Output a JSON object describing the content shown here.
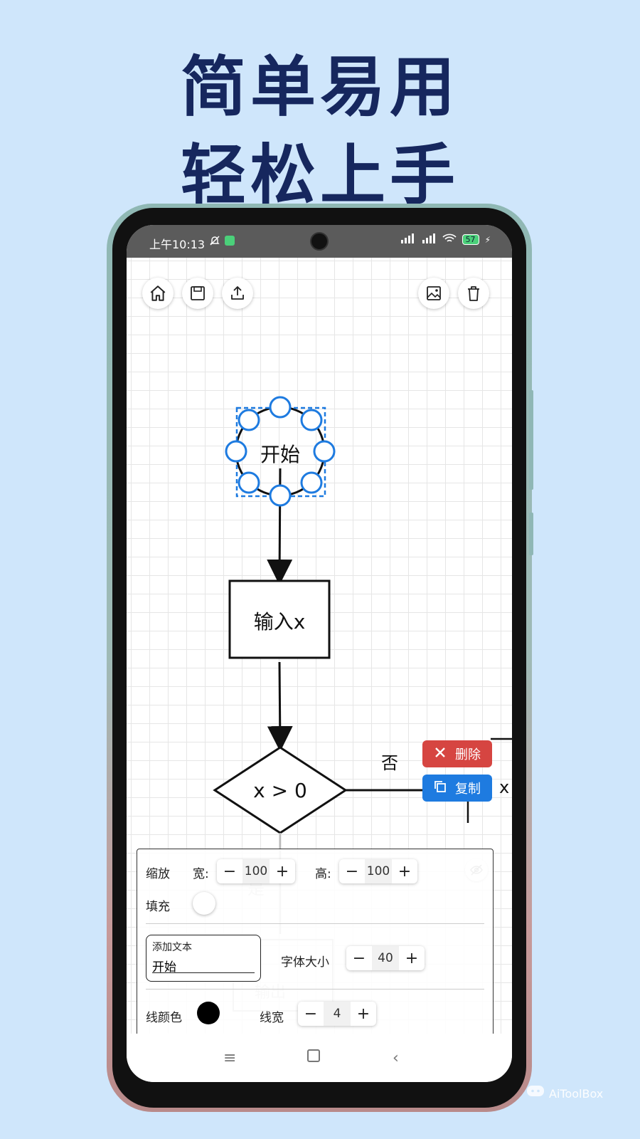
{
  "promo": {
    "line1": "简单易用",
    "line2": "轻松上手"
  },
  "status_bar": {
    "time": "上午10:13",
    "battery": "57"
  },
  "toolbar": {
    "home": "home-icon",
    "save": "save-icon",
    "export": "export-icon",
    "image": "image-icon",
    "delete": "trash-icon"
  },
  "diagram": {
    "start_label": "开始",
    "input_label": "输入x",
    "decision_label": "x > 0",
    "no_label": "否",
    "yes_label": "是",
    "output_fragment": "输出",
    "right_edge_fragment": "x"
  },
  "float_actions": {
    "delete_label": "删除",
    "copy_label": "复制"
  },
  "panel": {
    "scale_label": "缩放",
    "width_label": "宽:",
    "width_value": "100",
    "height_label": "高:",
    "height_value": "100",
    "fill_label": "填充",
    "add_text_label": "添加文本",
    "text_value": "开始",
    "font_size_label": "字体大小",
    "font_size_value": "40",
    "line_color_label": "线颜色",
    "line_color": "#000000",
    "line_width_label": "线宽",
    "line_width_value": "4"
  },
  "colors": {
    "accent": "#1e7be0",
    "danger": "#d64541",
    "heading": "#16275e",
    "background": "#cfe6fb"
  },
  "watermark": "AiToolBox"
}
